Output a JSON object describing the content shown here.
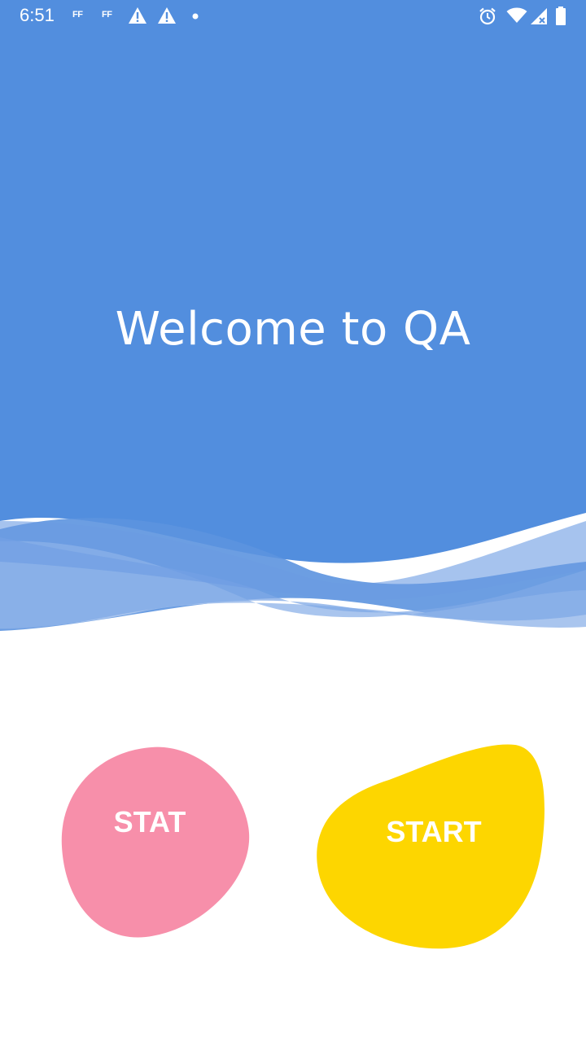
{
  "status_bar": {
    "time": "6:51",
    "notifications": [
      {
        "label": "FF",
        "icon": "firefox-ff-icon"
      },
      {
        "label": "FF",
        "icon": "firefox-ff-icon"
      },
      {
        "icon": "warning-icon"
      },
      {
        "icon": "warning-icon"
      },
      {
        "icon": "dot-icon"
      }
    ],
    "system_icons": [
      "alarm-icon",
      "wifi-icon",
      "signal-icon",
      "battery-icon"
    ]
  },
  "header": {
    "title": "Welcome to QA",
    "background_color": "#528EDE",
    "wave_color": "#A9C5EE"
  },
  "actions": {
    "stat_label": "STAT",
    "stat_color": "#F78FAA",
    "start_label": "START",
    "start_color": "#FDD600"
  }
}
